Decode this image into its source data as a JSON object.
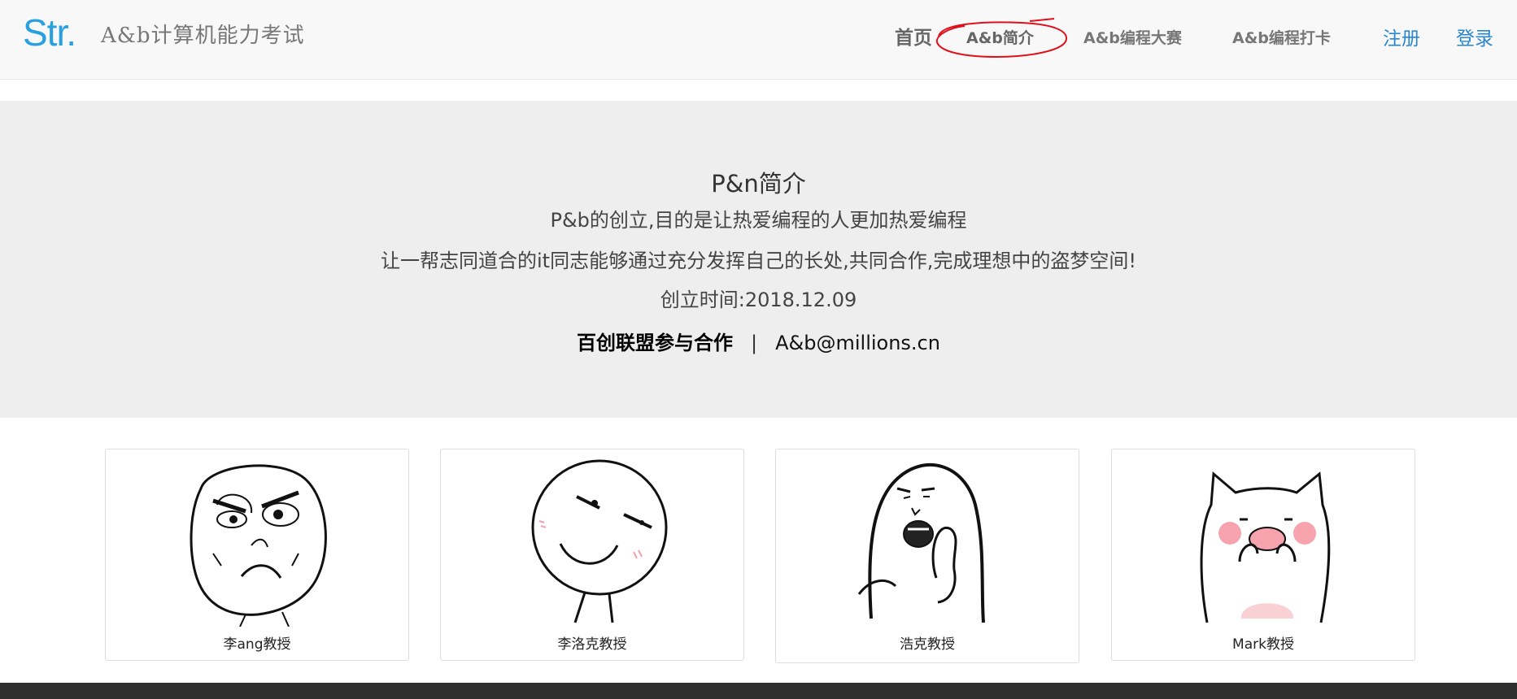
{
  "header": {
    "logo_mark": "Str.",
    "site_title": "A&b计算机能力考试",
    "nav": {
      "home": "首页",
      "intro": "A&b简介",
      "contest": "A&b编程大赛",
      "checkin": "A&b编程打卡"
    },
    "register": "注册",
    "login": "登录"
  },
  "intro": {
    "heading": "P&n简介",
    "line1": "P&b的创立,目的是让热爱编程的人更加热爱编程",
    "line2": "让一帮志同道合的it同志能够通过充分发挥自己的长处,共同合作,完成理想中的盗梦空间!",
    "line3": "创立时间:2018.12.09",
    "partner": "百创联盟参与合作",
    "separator": "|",
    "email": "A&b@millions.cn"
  },
  "cards": [
    {
      "name": "李ang教授",
      "icon": "rage-face-icon"
    },
    {
      "name": "李洛克教授",
      "icon": "smirk-face-icon"
    },
    {
      "name": "浩克教授",
      "icon": "shocked-blob-icon"
    },
    {
      "name": "Mark教授",
      "icon": "pink-cat-icon"
    }
  ],
  "colors": {
    "logo": "#2aa0e0",
    "link": "#2a86d0",
    "intro_bg": "#eeeeee",
    "annotation": "#e0101a",
    "footer": "#2f2f2f"
  }
}
